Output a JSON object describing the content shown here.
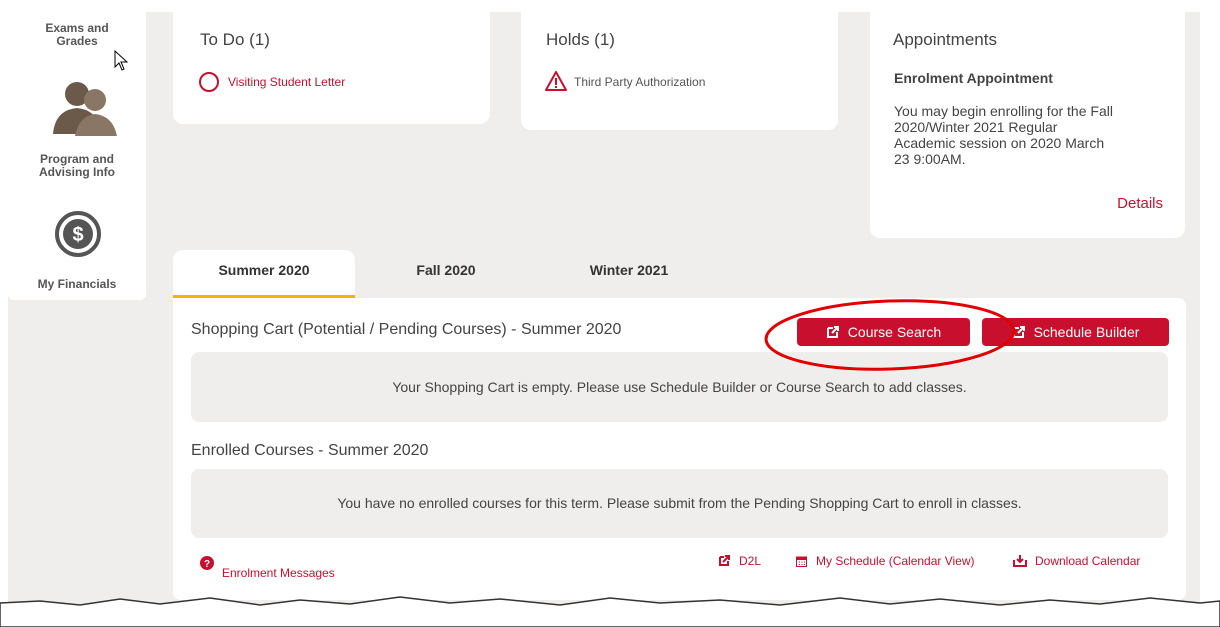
{
  "sidebar": {
    "exams_label_1": "Exams and",
    "exams_label_2": "Grades",
    "program_label_1": "Program and",
    "program_label_2": "Advising Info",
    "financials_label": "My Financials"
  },
  "todo": {
    "title": "To Do (1)",
    "item": "Visiting Student Letter"
  },
  "holds": {
    "title": "Holds (1)",
    "item": "Third Party Authorization"
  },
  "appointments": {
    "title": "Appointments",
    "subtitle": "Enrolment Appointment",
    "text_1": "You may begin enrolling for the Fall",
    "text_2": "2020/Winter 2021 Regular",
    "text_3": "Academic session on 2020 March",
    "text_4": "23 9:00AM.",
    "details": "Details"
  },
  "tabs": [
    {
      "label": "Summer 2020",
      "active": true
    },
    {
      "label": "Fall 2020",
      "active": false
    },
    {
      "label": "Winter 2021",
      "active": false
    }
  ],
  "shopping_cart": {
    "title": "Shopping Cart (Potential / Pending Courses) - Summer 2020",
    "course_search": "Course Search",
    "schedule_builder": "Schedule Builder",
    "empty_message": "Your Shopping Cart is empty. Please use Schedule Builder or Course Search to add classes."
  },
  "enrolled": {
    "title": "Enrolled Courses - Summer 2020",
    "empty_message": "You have no enrolled courses for this term. Please submit from the Pending Shopping Cart to enroll in classes."
  },
  "footer": {
    "enrolment_messages": "Enrolment Messages",
    "d2l": "D2L",
    "my_schedule": "My Schedule (Calendar View)",
    "download_calendar": "Download Calendar"
  },
  "colors": {
    "accent": "#c8102e",
    "tab_underline": "#f2b705",
    "background": "#efeeec",
    "annotation": "#e00000"
  },
  "icons": [
    "cursor-arrow-icon",
    "people-icon",
    "dollar-icon",
    "circle-todo-icon",
    "warning-icon",
    "external-link-icon",
    "question-icon",
    "calendar-icon",
    "download-icon"
  ]
}
